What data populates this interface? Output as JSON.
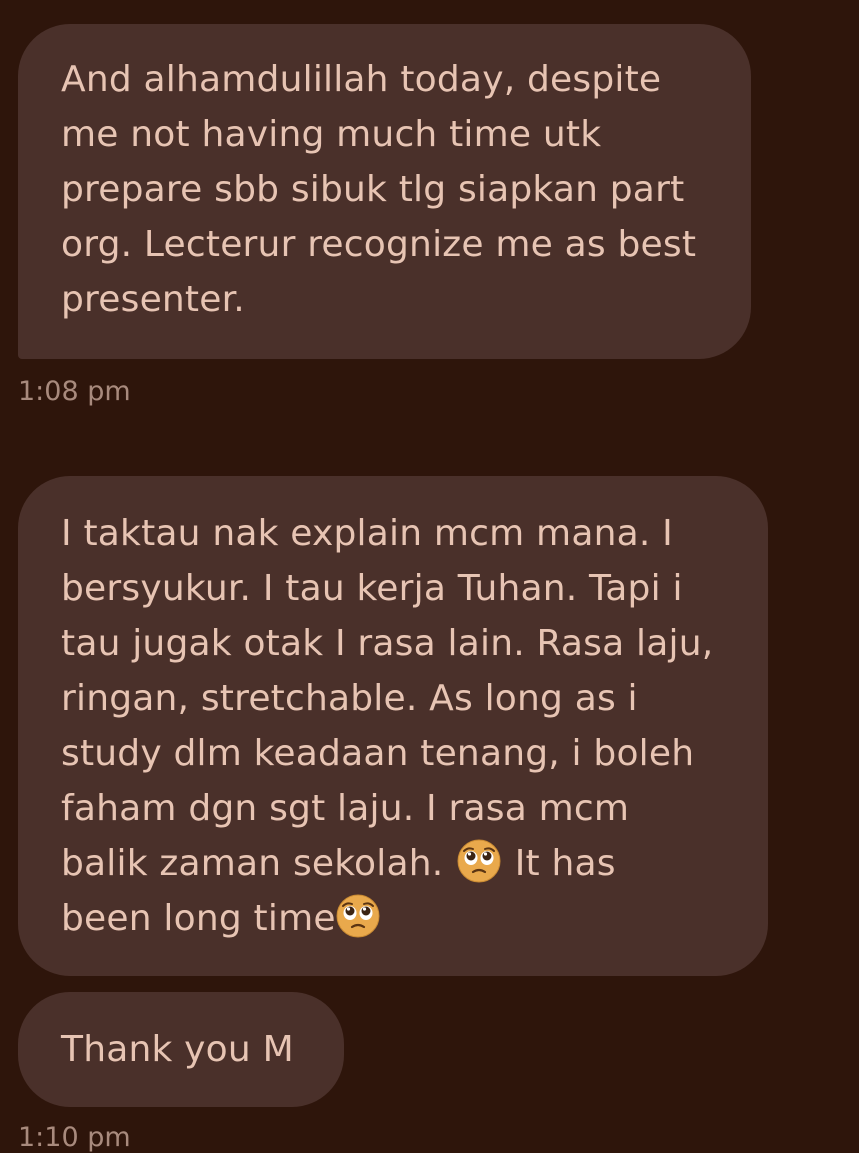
{
  "messages": [
    {
      "lines": [
        "And alhamdulillah today, despite",
        "me not having much time utk",
        "prepare sbb sibuk tlg siapkan part",
        "org. Lecterur recognize me as best",
        "presenter."
      ],
      "timestamp": "1:08 pm"
    },
    {
      "lines": [
        "I taktau nak explain mcm mana. I",
        "bersyukur. I tau kerja Tuhan. Tapi i",
        "tau jugak otak I rasa lain. Rasa laju,",
        "ringan, stretchable. As long as i",
        "study dlm keadaan tenang, i boleh",
        "faham dgn sgt laju. I rasa mcm",
        "balik zaman sekolah.",
        "It has",
        "been long time"
      ],
      "emoji": "pleading-face"
    },
    {
      "lines": [
        "Thank you M"
      ],
      "timestamp": "1:10 pm"
    }
  ],
  "colors": {
    "background": "#2e150b",
    "bubble": "#4a302a",
    "text": "#e7c4b3",
    "timestamp": "#a88a7d"
  }
}
